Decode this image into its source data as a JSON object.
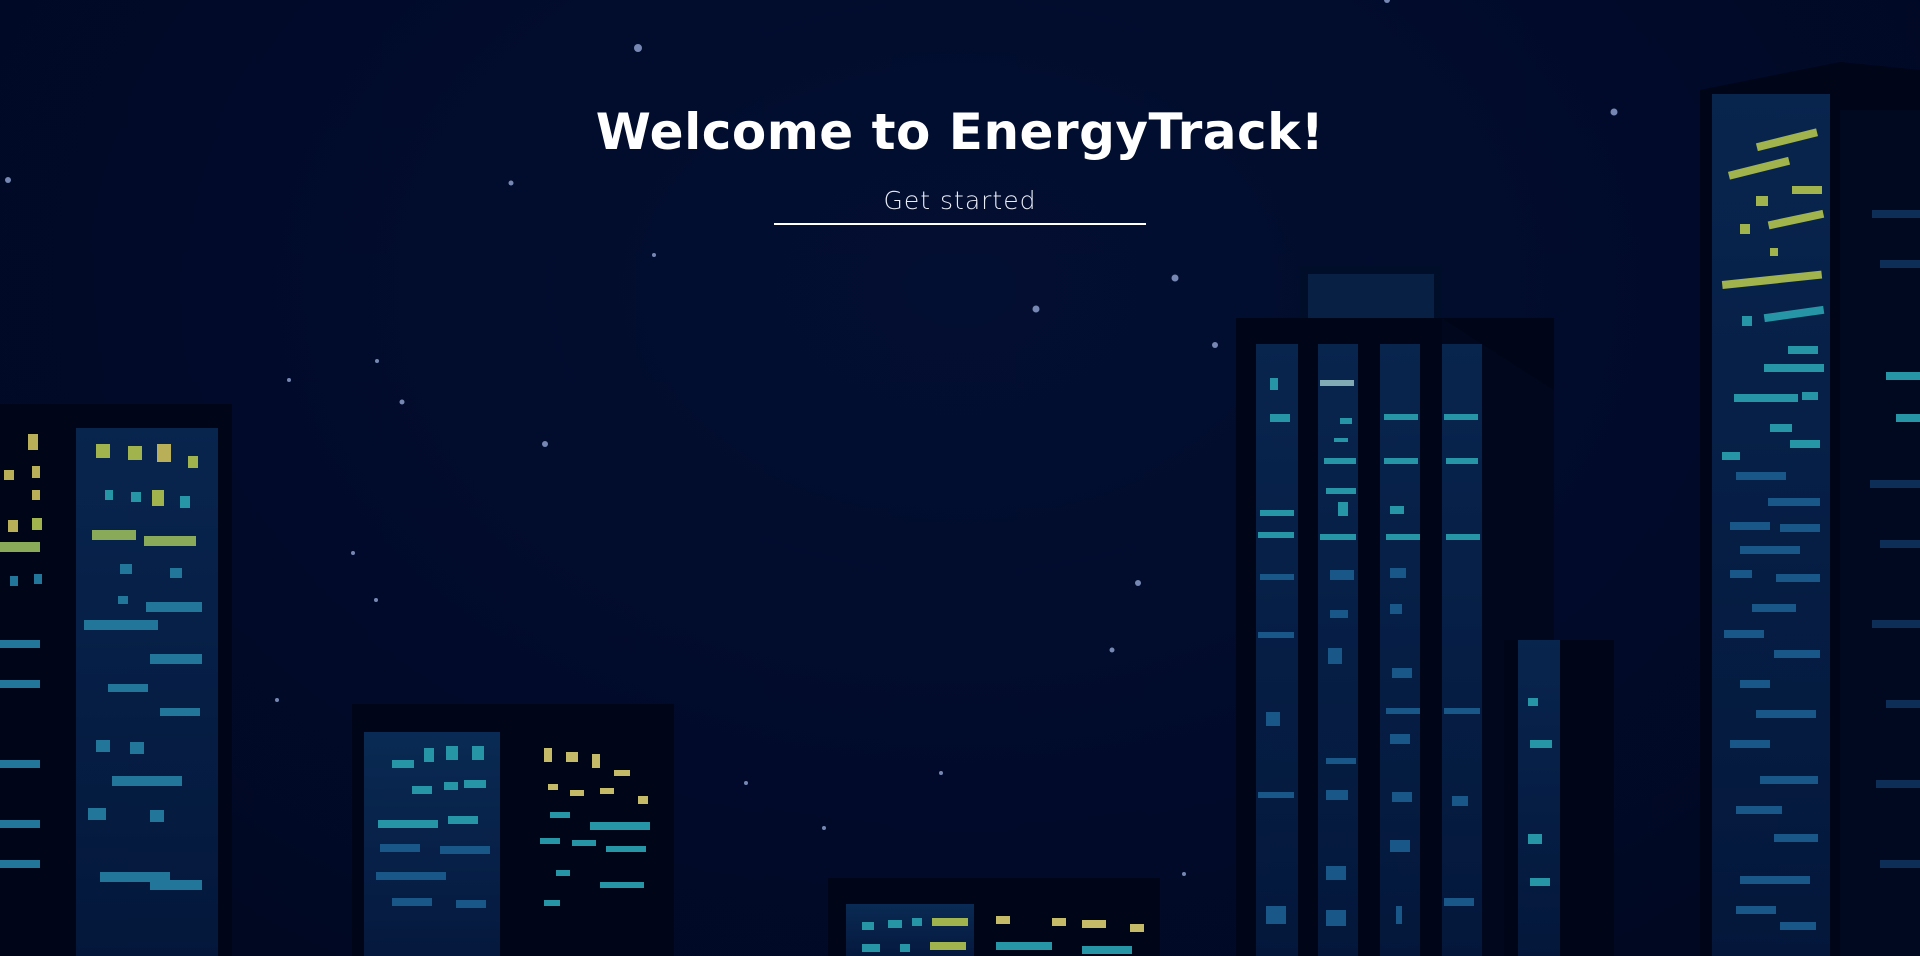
{
  "hero": {
    "title": "Welcome to EnergyTrack!",
    "cta_label": "Get started"
  },
  "background": {
    "description_icon": "night-city-skyline-illustration",
    "sky_color": "#020c30",
    "building_color": "#01051a",
    "window_colors": [
      "#2fb6c9",
      "#c4d95a",
      "#f1e27a",
      "#1c5a8a"
    ]
  }
}
